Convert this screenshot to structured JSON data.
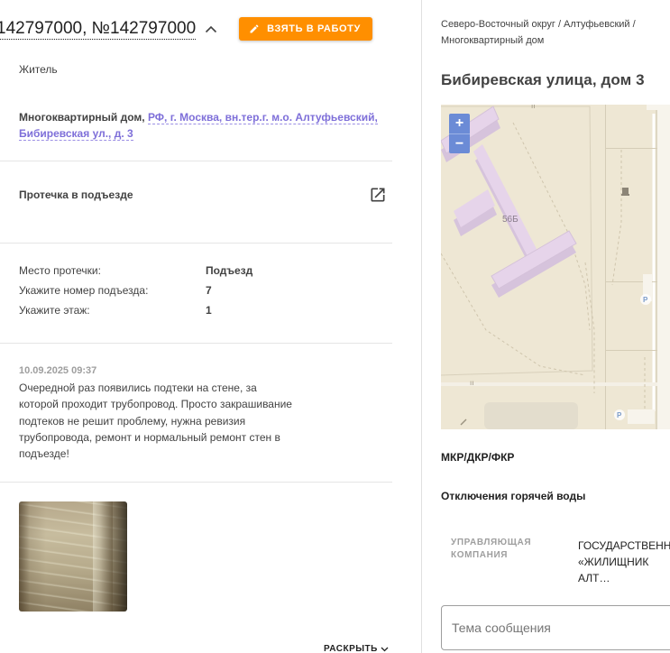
{
  "ticket": {
    "title": "142797000, №142797000",
    "take_button": "ВЗЯТЬ В РАБОТУ",
    "role": "Житель",
    "address_prefix": "Многоквартирный дом,",
    "address_link": "РФ, г. Москва, вн.тер.г. м.о. Алтуфьевский, Бибиревская ул., д. 3",
    "issue_title": "Протечка в подъезде",
    "fields": [
      {
        "key": "Место протечки:",
        "value": "Подъезд"
      },
      {
        "key": "Укажите номер подъезда:",
        "value": "7"
      },
      {
        "key": "Укажите этаж:",
        "value": "1"
      }
    ],
    "comment": {
      "date": "10.09.2025 09:37",
      "text": "Очередной раз появились подтеки на стене, за которой проходит трубопровод. Просто закрашивание подтеков не решит проблему, нужна ревизия трубопровода, ремонт и нормальный ремонт стен в подъезде!"
    },
    "expand_label": "РАСКРЫТЬ"
  },
  "location": {
    "breadcrumbs": "Северо-Восточный округ / Алтуфьевский / Многоквартирный дом",
    "street": "Бибиревская улица, дом 3",
    "map": {
      "zoom_in": "+",
      "zoom_out": "−",
      "building_number": "56Б",
      "parking_label": "P"
    },
    "programs_title": "МКР/ДКР/ФКР",
    "hot_water_title": "Отключения горячей воды",
    "management_company_label": "УПРАВЛЯЮЩАЯ КОМПАНИЯ",
    "management_company_value": "ГОСУДАРСТВЕНН… «ЖИЛИЩНИК АЛТ…",
    "message_placeholder": "Тема сообщения"
  },
  "colors": {
    "accent_orange": "#ff8f00",
    "link_purple": "#7e6fd9",
    "map_bg": "#eee7d4",
    "building_fill": "#e6d4ea",
    "zoom_blue": "#6b8bd6"
  }
}
